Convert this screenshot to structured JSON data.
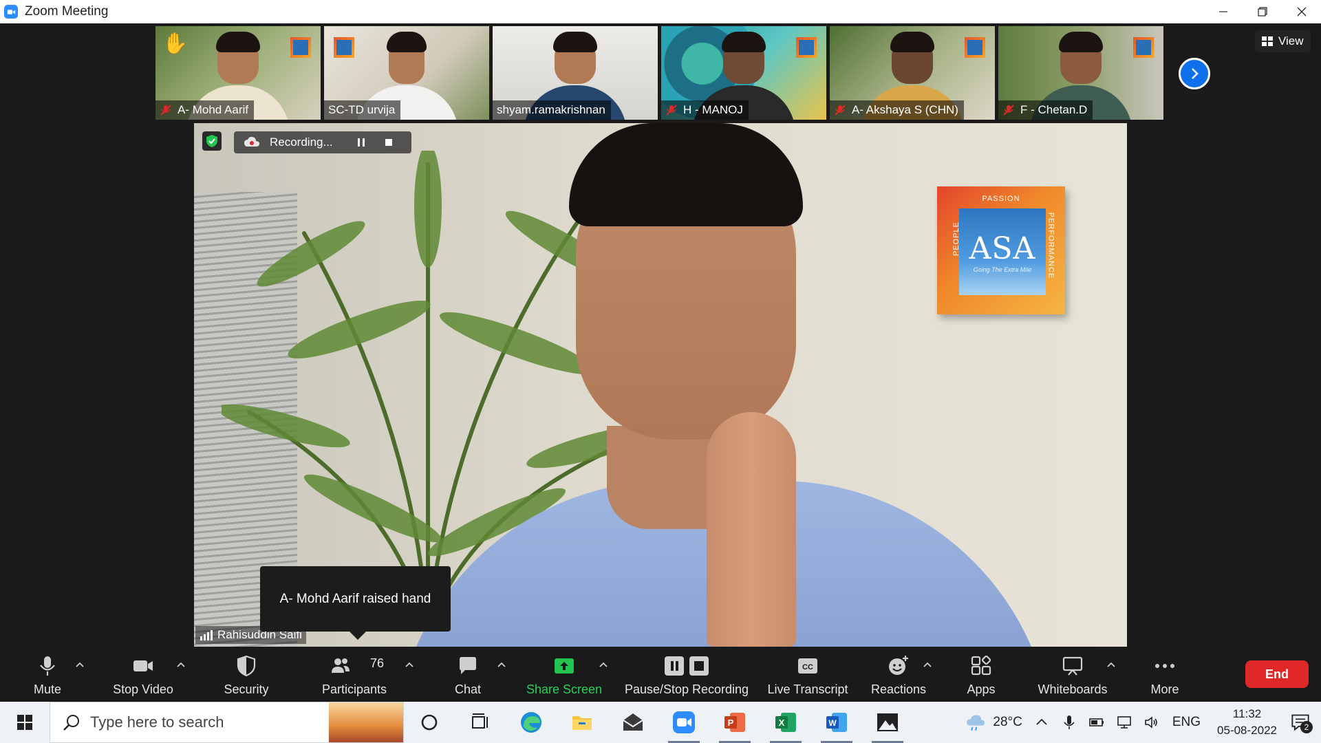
{
  "window": {
    "title": "Zoom Meeting"
  },
  "gallery": {
    "tiles": [
      {
        "name": "A- Mohd Aarif",
        "muted": true,
        "hand_raised": true
      },
      {
        "name": "SC-TD urvija",
        "muted": false,
        "hand_raised": false
      },
      {
        "name": "shyam.ramakrishnan",
        "muted": false,
        "hand_raised": false
      },
      {
        "name": "H - MANOJ",
        "muted": true,
        "hand_raised": false
      },
      {
        "name": "A- Akshaya S (CHN)",
        "muted": true,
        "hand_raised": false
      },
      {
        "name": "F - Chetan.D",
        "muted": true,
        "hand_raised": false
      }
    ],
    "view_label": "View"
  },
  "main": {
    "recording_label": "Recording...",
    "speaker_name": "Rahisuddin Saifi",
    "poster": {
      "brand": "ASA",
      "top": "PASSION",
      "left": "PEOPLE",
      "right": "PERFORMANCE",
      "tagline": "Going The Extra Mile"
    },
    "toast": "A- Mohd Aarif raised hand"
  },
  "toolbar": {
    "mute": "Mute",
    "stop_video": "Stop Video",
    "security": "Security",
    "participants": "Participants",
    "participants_count": "76",
    "chat": "Chat",
    "share_screen": "Share Screen",
    "pause_stop_recording": "Pause/Stop Recording",
    "live_transcript": "Live Transcript",
    "reactions": "Reactions",
    "apps": "Apps",
    "whiteboards": "Whiteboards",
    "more": "More",
    "end": "End",
    "share_color": "#2ad15a",
    "end_color": "#e02828"
  },
  "taskbar": {
    "search_placeholder": "Type here to search",
    "weather": "28°C",
    "language": "ENG",
    "time": "11:32",
    "date": "05-08-2022",
    "notification_count": "2"
  }
}
